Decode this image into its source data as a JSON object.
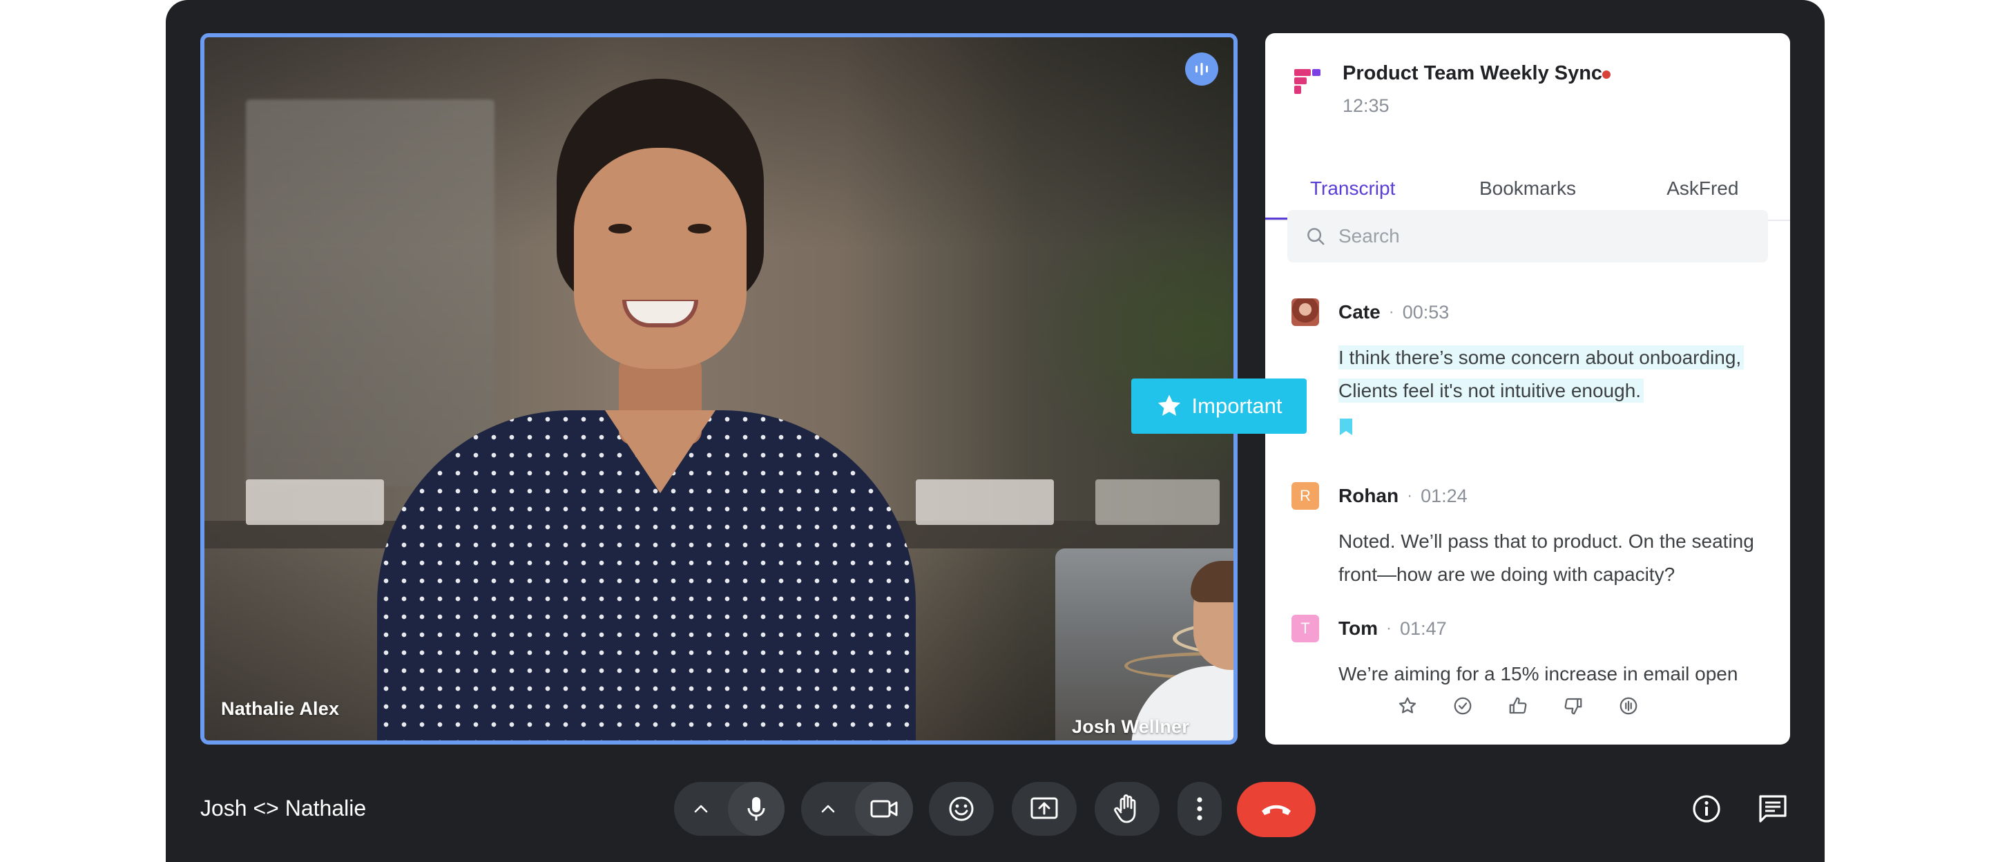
{
  "video": {
    "main_participant": "Nathalie Alex",
    "pip_participant": "Josh Wellner"
  },
  "tag": {
    "label": "Important",
    "icon": "star-icon",
    "color": "#21c3ea"
  },
  "panel": {
    "title": "Product Team Weekly Sync",
    "time": "12:35",
    "tabs": [
      {
        "label": "Transcript",
        "active": true
      },
      {
        "label": "Bookmarks",
        "active": false
      },
      {
        "label": "AskFred",
        "active": false
      }
    ],
    "search_placeholder": "Search",
    "transcript": [
      {
        "speaker": "Cate",
        "time": "00:53",
        "initial": "",
        "text": "I think there’s some concern about onboarding, Clients feel it's not intuitive enough.",
        "highlighted": true,
        "bookmarked": true
      },
      {
        "speaker": "Rohan",
        "time": "01:24",
        "initial": "R",
        "text": "Noted. We’ll pass that to product. On the seating front—how are we doing with capacity?",
        "highlighted": false,
        "bookmarked": false
      },
      {
        "speaker": "Tom",
        "time": "01:47",
        "initial": "T",
        "text": "We’re aiming for a 15% increase in email open",
        "highlighted": false,
        "bookmarked": false
      }
    ],
    "reactions": [
      "star-icon",
      "check-circle-icon",
      "thumbs-up-icon",
      "thumbs-down-icon",
      "audio-icon"
    ],
    "separator": "·"
  },
  "bottom_bar": {
    "meeting_name": "Josh <> Nathalie",
    "controls": [
      "chevron-up-icon",
      "microphone-icon",
      "chevron-up-icon",
      "camera-icon",
      "emoji-icon",
      "present-screen-icon",
      "raise-hand-icon",
      "more-options-icon",
      "end-call-icon"
    ],
    "right_controls": [
      "info-icon",
      "chat-icon"
    ]
  },
  "colors": {
    "accent": "#5a3cd6",
    "active_border": "#6b9cf1",
    "end_call": "#ea4335",
    "highlight": "#e5f8fc",
    "background": "#202124"
  }
}
